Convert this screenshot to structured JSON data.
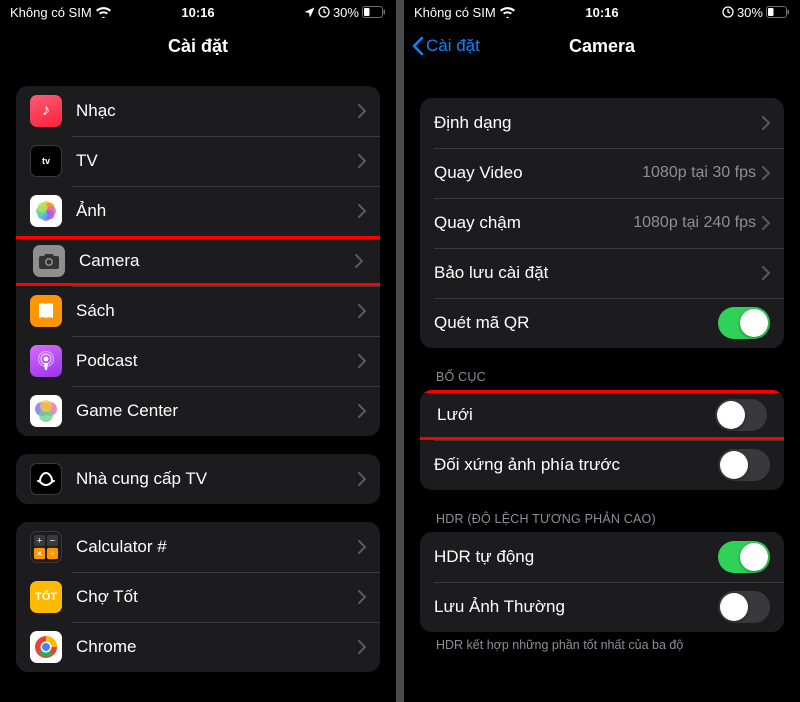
{
  "statusBar": {
    "carrier": "Không có SIM",
    "time": "10:16",
    "battery": "30%"
  },
  "left": {
    "title": "Cài đặt",
    "groups": [
      {
        "rows": [
          {
            "icon": "music",
            "label": "Nhạc"
          },
          {
            "icon": "tv",
            "label": "TV"
          },
          {
            "icon": "photos",
            "label": "Ảnh"
          },
          {
            "icon": "camera",
            "label": "Camera",
            "highlight": true
          },
          {
            "icon": "books",
            "label": "Sách"
          },
          {
            "icon": "podcast",
            "label": "Podcast"
          },
          {
            "icon": "gamecenter",
            "label": "Game Center"
          }
        ]
      },
      {
        "rows": [
          {
            "icon": "tvprovider",
            "label": "Nhà cung cấp TV"
          }
        ]
      },
      {
        "rows": [
          {
            "icon": "calculator",
            "label": "Calculator #"
          },
          {
            "icon": "chotot",
            "label": "Chợ Tốt"
          },
          {
            "icon": "chrome",
            "label": "Chrome"
          }
        ]
      }
    ]
  },
  "right": {
    "back": "Cài đặt",
    "title": "Camera",
    "group1": [
      {
        "label": "Định dạng",
        "type": "link"
      },
      {
        "label": "Quay Video",
        "value": "1080p tại 30 fps",
        "type": "link"
      },
      {
        "label": "Quay chậm",
        "value": "1080p tại 240 fps",
        "type": "link"
      },
      {
        "label": "Bảo lưu cài đặt",
        "type": "link"
      },
      {
        "label": "Quét mã QR",
        "type": "toggle",
        "on": true
      }
    ],
    "group2_header": "BỐ CỤC",
    "group2": [
      {
        "label": "Lưới",
        "type": "toggle",
        "on": false,
        "highlight": true
      },
      {
        "label": "Đối xứng ảnh phía trước",
        "type": "toggle",
        "on": false
      }
    ],
    "group3_header": "HDR (ĐỘ LỆCH TƯƠNG PHẢN CAO)",
    "group3": [
      {
        "label": "HDR tự động",
        "type": "toggle",
        "on": true
      },
      {
        "label": "Lưu Ảnh Thường",
        "type": "toggle",
        "on": false
      }
    ],
    "group3_footer": "HDR kết hợp những phần tốt nhất của ba độ"
  }
}
